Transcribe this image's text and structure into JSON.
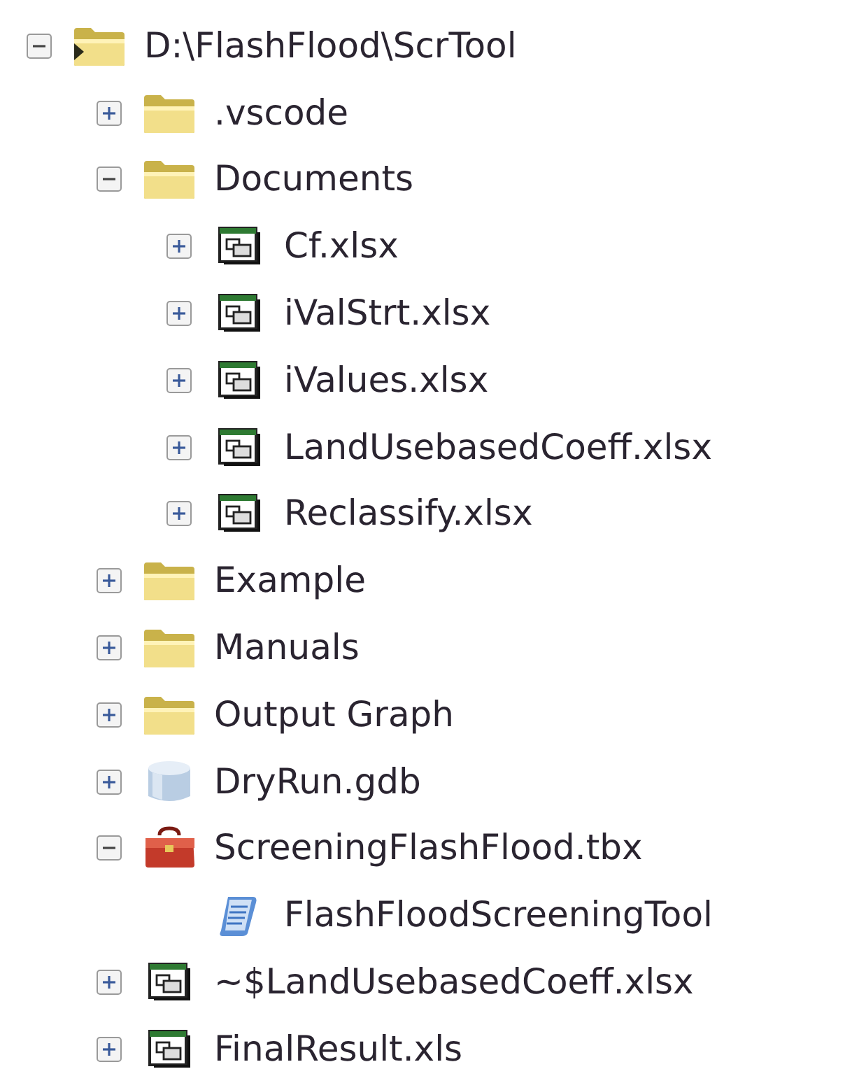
{
  "tree": [
    {
      "label": "D:\\FlashFlood\\ScrTool",
      "kind": "root",
      "expanded": true,
      "children": [
        {
          "label": ".vscode",
          "kind": "folder",
          "expanded": false
        },
        {
          "label": "Documents",
          "kind": "folder",
          "expanded": true,
          "children": [
            {
              "label": "Cf.xlsx",
              "kind": "table",
              "expanded": false
            },
            {
              "label": "iValStrt.xlsx",
              "kind": "table",
              "expanded": false
            },
            {
              "label": "iValues.xlsx",
              "kind": "table",
              "expanded": false
            },
            {
              "label": "LandUsebasedCoeff.xlsx",
              "kind": "table",
              "expanded": false
            },
            {
              "label": "Reclassify.xlsx",
              "kind": "table",
              "expanded": false
            }
          ]
        },
        {
          "label": "Example",
          "kind": "folder",
          "expanded": false
        },
        {
          "label": "Manuals",
          "kind": "folder",
          "expanded": false
        },
        {
          "label": "Output Graph",
          "kind": "folder",
          "expanded": false
        },
        {
          "label": "DryRun.gdb",
          "kind": "database",
          "expanded": false
        },
        {
          "label": "ScreeningFlashFlood.tbx",
          "kind": "toolbox",
          "expanded": true,
          "children": [
            {
              "label": "FlashFloodScreeningTool",
              "kind": "script"
            }
          ]
        },
        {
          "label": "~$LandUsebasedCoeff.xlsx",
          "kind": "table",
          "expanded": false
        },
        {
          "label": "FinalResult.xls",
          "kind": "table",
          "expanded": false
        }
      ]
    }
  ]
}
